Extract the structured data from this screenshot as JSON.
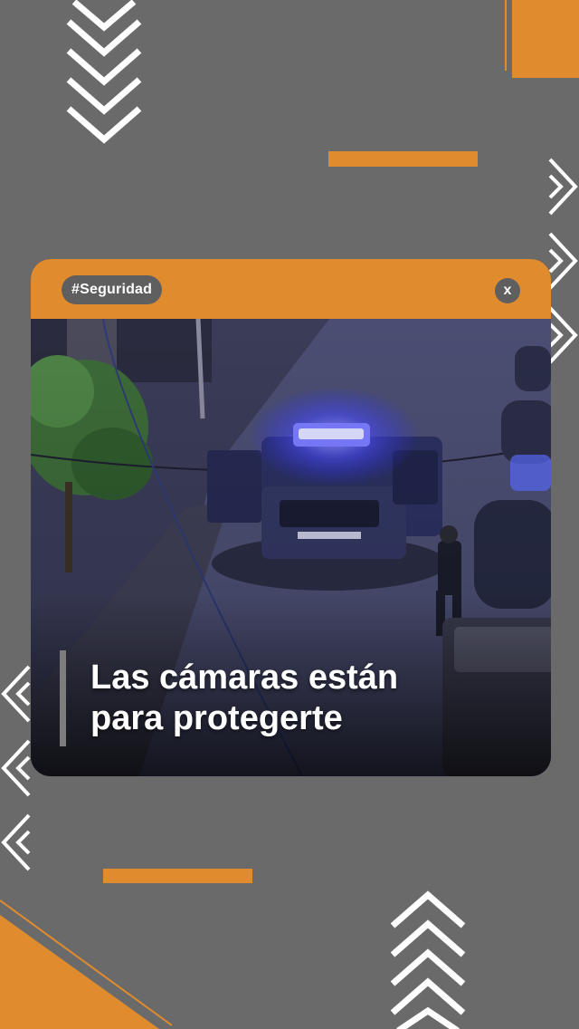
{
  "post": {
    "tag": "#Seguridad",
    "close_label": "x",
    "headline_line1": "Las cámaras están",
    "headline_line2": "para protegerte"
  },
  "colors": {
    "background": "#6a6a6a",
    "accent": "#e08c2e",
    "pill": "#5f5f5f",
    "chevron": "#ffffff"
  },
  "decor_icons": [
    "chevron-down-stack-icon",
    "chevron-right-stack-icon",
    "chevron-left-stack-icon",
    "chevron-up-stack-icon"
  ]
}
